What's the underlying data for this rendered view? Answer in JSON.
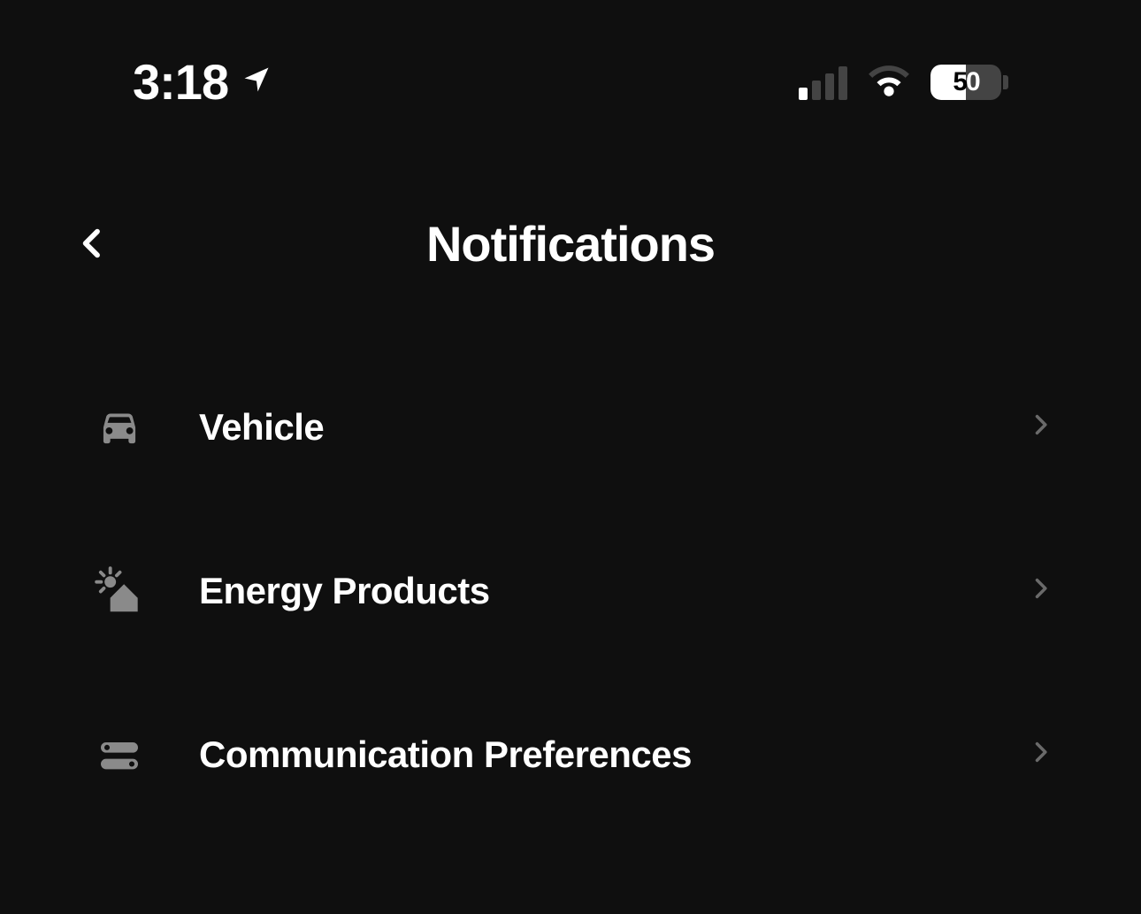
{
  "status_bar": {
    "time": "3:18",
    "battery_percent": "50"
  },
  "header": {
    "title": "Notifications"
  },
  "menu": {
    "items": [
      {
        "label": "Vehicle"
      },
      {
        "label": "Energy Products"
      },
      {
        "label": "Communication Preferences"
      }
    ]
  }
}
